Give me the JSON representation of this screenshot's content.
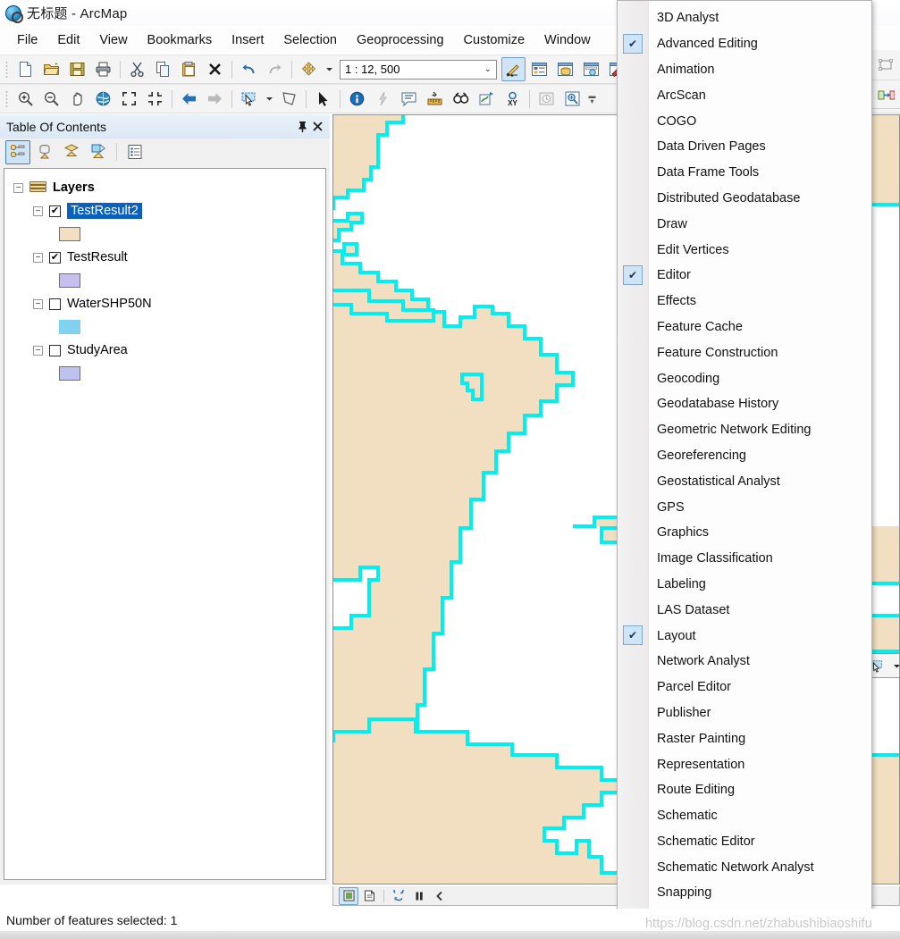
{
  "window": {
    "title": "无标题 - ArcMap",
    "app_icon": "arcmap-globe-icon"
  },
  "menubar": {
    "items": [
      {
        "label": "File"
      },
      {
        "label": "Edit"
      },
      {
        "label": "View"
      },
      {
        "label": "Bookmarks"
      },
      {
        "label": "Insert"
      },
      {
        "label": "Selection"
      },
      {
        "label": "Geoprocessing"
      },
      {
        "label": "Customize"
      },
      {
        "label": "Window"
      }
    ]
  },
  "standard_toolbar": {
    "buttons": [
      {
        "name": "new-map-icon"
      },
      {
        "name": "open-icon"
      },
      {
        "name": "save-icon"
      },
      {
        "name": "print-icon"
      },
      {
        "name": "cut-icon"
      },
      {
        "name": "copy-icon"
      },
      {
        "name": "paste-icon"
      },
      {
        "name": "delete-icon"
      },
      {
        "name": "undo-icon"
      },
      {
        "name": "redo-icon"
      },
      {
        "name": "add-data-icon"
      }
    ],
    "scale": {
      "value": "1 : 12, 500",
      "chevron": "⌄"
    },
    "right_buttons": [
      {
        "name": "editor-toolbar-icon"
      },
      {
        "name": "table-of-contents-icon"
      },
      {
        "name": "catalog-icon"
      },
      {
        "name": "search-window-icon"
      },
      {
        "name": "arctoolbox-icon"
      }
    ]
  },
  "tools_toolbar": {
    "buttons": [
      {
        "name": "zoom-in-icon"
      },
      {
        "name": "zoom-out-icon"
      },
      {
        "name": "pan-icon"
      },
      {
        "name": "full-extent-icon"
      },
      {
        "name": "fixed-zoom-in-icon"
      },
      {
        "name": "fixed-zoom-out-icon"
      },
      {
        "name": "go-back-extent-icon"
      },
      {
        "name": "go-next-extent-icon"
      },
      {
        "name": "select-features-icon"
      },
      {
        "name": "select-by-polygon-icon"
      },
      {
        "name": "select-elements-icon"
      },
      {
        "name": "identify-icon"
      },
      {
        "name": "hyperlink-icon"
      },
      {
        "name": "html-popup-icon"
      },
      {
        "name": "measure-icon"
      },
      {
        "name": "find-icon"
      },
      {
        "name": "find-route-icon"
      },
      {
        "name": "go-to-xy-icon"
      },
      {
        "name": "time-slider-icon"
      },
      {
        "name": "create-viewer-window-icon"
      }
    ]
  },
  "table_of_contents": {
    "title": "Table Of Contents",
    "pin_icon": "pin-icon",
    "close_icon": "close-icon",
    "toolbar_buttons": [
      {
        "name": "list-by-drawing-order-icon",
        "selected": true
      },
      {
        "name": "list-by-source-icon",
        "selected": false
      },
      {
        "name": "list-by-visibility-icon",
        "selected": false
      },
      {
        "name": "list-by-selection-icon",
        "selected": false
      },
      {
        "name": "options-icon",
        "selected": false
      }
    ],
    "root": {
      "label": "Layers",
      "expander": "−"
    },
    "layers": [
      {
        "label": "TestResult2",
        "checked": true,
        "selected": true,
        "swatch": "#f2dfc1",
        "expander": "−"
      },
      {
        "label": "TestResult",
        "checked": true,
        "selected": false,
        "swatch": "#c5c0ee",
        "expander": "−"
      },
      {
        "label": "WaterSHP50N",
        "checked": false,
        "selected": false,
        "swatch": "#7fd3ef",
        "expander": "−"
      },
      {
        "label": "StudyArea",
        "checked": false,
        "selected": false,
        "swatch": "#bdc2ee",
        "expander": "−"
      }
    ]
  },
  "map": {
    "fill_color": "#f2dfc1",
    "selection_color": "#00f0f0",
    "background_color": "#ffffff",
    "bottom_bar": {
      "buttons": [
        {
          "name": "data-view-icon",
          "selected": true
        },
        {
          "name": "layout-view-icon",
          "selected": false
        },
        {
          "name": "refresh-view-icon",
          "selected": false
        },
        {
          "name": "pause-drawing-icon",
          "selected": false
        },
        {
          "name": "collapse-panel-icon",
          "selected": false
        }
      ]
    },
    "floating_toolbar": {
      "buttons": [
        {
          "name": "select-features-icon"
        },
        {
          "name": "chevron-down-icon"
        }
      ]
    }
  },
  "toolbars_dropdown": {
    "scroll_down_icon": "scroll-down-arrow-icon",
    "items": [
      {
        "label": "3D Analyst",
        "checked": false
      },
      {
        "label": "Advanced Editing",
        "checked": true
      },
      {
        "label": "Animation",
        "checked": false
      },
      {
        "label": "ArcScan",
        "checked": false
      },
      {
        "label": "COGO",
        "checked": false
      },
      {
        "label": "Data Driven Pages",
        "checked": false
      },
      {
        "label": "Data Frame Tools",
        "checked": false
      },
      {
        "label": "Distributed Geodatabase",
        "checked": false
      },
      {
        "label": "Draw",
        "checked": false
      },
      {
        "label": "Edit Vertices",
        "checked": false
      },
      {
        "label": "Editor",
        "checked": true
      },
      {
        "label": "Effects",
        "checked": false
      },
      {
        "label": "Feature Cache",
        "checked": false
      },
      {
        "label": "Feature Construction",
        "checked": false
      },
      {
        "label": "Geocoding",
        "checked": false
      },
      {
        "label": "Geodatabase History",
        "checked": false
      },
      {
        "label": "Geometric Network Editing",
        "checked": false
      },
      {
        "label": "Georeferencing",
        "checked": false
      },
      {
        "label": "Geostatistical Analyst",
        "checked": false
      },
      {
        "label": "GPS",
        "checked": false
      },
      {
        "label": "Graphics",
        "checked": false
      },
      {
        "label": "Image Classification",
        "checked": false
      },
      {
        "label": "Labeling",
        "checked": false
      },
      {
        "label": "LAS Dataset",
        "checked": false
      },
      {
        "label": "Layout",
        "checked": true
      },
      {
        "label": "Network Analyst",
        "checked": false
      },
      {
        "label": "Parcel Editor",
        "checked": false
      },
      {
        "label": "Publisher",
        "checked": false
      },
      {
        "label": "Raster Painting",
        "checked": false
      },
      {
        "label": "Representation",
        "checked": false
      },
      {
        "label": "Route Editing",
        "checked": false
      },
      {
        "label": "Schematic",
        "checked": false
      },
      {
        "label": "Schematic Editor",
        "checked": false
      },
      {
        "label": "Schematic Network Analyst",
        "checked": false
      },
      {
        "label": "Snapping",
        "checked": false
      }
    ]
  },
  "statusbar": {
    "text": "Number of features selected: 1"
  },
  "watermark": {
    "text": "https://blog.csdn.net/zhabushibiaoshifu"
  }
}
